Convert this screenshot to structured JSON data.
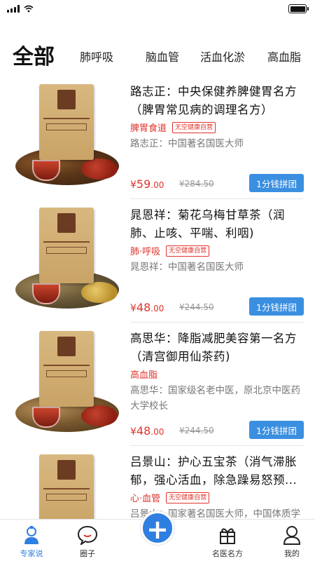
{
  "tabs": [
    "全部",
    "肺呼吸",
    "脑血管",
    "活血化淤",
    "高血脂"
  ],
  "products": [
    {
      "title": "路志正：中央保健养脾健胃名方（脾胃常见病的调理名方）",
      "category": "脾胃食道",
      "badge": "无空健康自营",
      "doctor": "路志正：中国著名国医大师",
      "price_symbol": "¥",
      "price_int": "59",
      "price_dec": ".00",
      "original_price": "¥284.50",
      "button": "1分钱拼团"
    },
    {
      "title": "晁恩祥：菊花乌梅甘草茶（润肺、止咳、平喘、利咽)",
      "category": "肺·呼吸",
      "badge": "无空健康自营",
      "doctor": "晁恩祥：中国著名国医大师",
      "price_symbol": "¥",
      "price_int": "48",
      "price_dec": ".00",
      "original_price": "¥244.50",
      "button": "1分钱拼团"
    },
    {
      "title": "高思华：降脂减肥美容第一名方（清宫御用仙茶药)",
      "category": "高血脂",
      "badge": "",
      "doctor": "高思华：国家级名老中医，原北京中医药大学校长",
      "price_symbol": "¥",
      "price_int": "48",
      "price_dec": ".00",
      "original_price": "¥244.50",
      "button": "1分钱拼团"
    },
    {
      "title": "吕景山：护心五宝茶（消气滞胀郁，强心活血，除急躁易怒预...",
      "category": "心·血管",
      "badge": "无空健康自营",
      "doctor": "吕景山：国家著名国医大师，中国体质学",
      "price_symbol": "",
      "price_int": "",
      "price_dec": "",
      "original_price": "",
      "button": ""
    }
  ],
  "nav": {
    "expert": "专家说",
    "circle": "圈子",
    "add": "+",
    "famous": "名医名方",
    "mine": "我的"
  },
  "colors": {
    "accent": "#2f7fe0",
    "price": "#e0342c",
    "button": "#3b8fe0"
  }
}
